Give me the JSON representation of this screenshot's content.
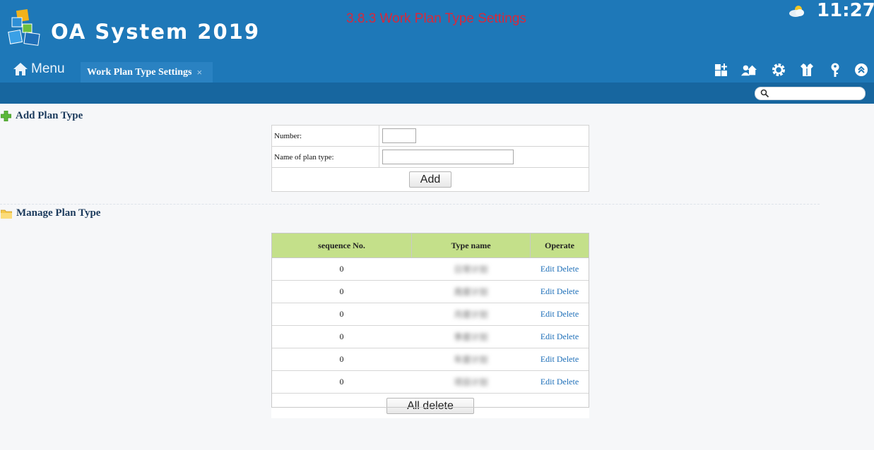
{
  "header": {
    "app_title": "OA System 2019",
    "page_heading": "3.8.3 Work Plan Type Settings",
    "clock": "11:27",
    "weather_icon": "partly-cloudy-icon",
    "menu_label": "Menu",
    "tab_label": "Work Plan Type Settings",
    "tab_close": "×",
    "toolbar_icons": [
      "dashboard-add-icon",
      "user-home-icon",
      "gear-icon",
      "shirt-icon",
      "key-icon",
      "collapse-up-icon"
    ],
    "search_placeholder": ""
  },
  "add_section": {
    "heading": "Add Plan Type",
    "number_label": "Number:",
    "number_value": "",
    "name_label": "Name of plan type:",
    "name_value": "",
    "add_button": "Add"
  },
  "manage_section": {
    "heading": "Manage Plan Type",
    "columns": [
      "sequence No.",
      "Type name",
      "Operate"
    ],
    "rows": [
      {
        "seq": "0",
        "name": "日常计划",
        "edit": "Edit",
        "delete": "Delete"
      },
      {
        "seq": "0",
        "name": "周度计划",
        "edit": "Edit",
        "delete": "Delete"
      },
      {
        "seq": "0",
        "name": "月度计划",
        "edit": "Edit",
        "delete": "Delete"
      },
      {
        "seq": "0",
        "name": "季度计划",
        "edit": "Edit",
        "delete": "Delete"
      },
      {
        "seq": "0",
        "name": "年度计划",
        "edit": "Edit",
        "delete": "Delete"
      },
      {
        "seq": "0",
        "name": "项目计划",
        "edit": "Edit",
        "delete": "Delete"
      }
    ],
    "all_delete_button": "All delete"
  },
  "colors": {
    "header_blue": "#1e78b8",
    "subbar_blue": "#17669f",
    "table_header_green": "#c4e08a",
    "heading_red": "#d8283b",
    "link_blue": "#1e6fb8"
  }
}
